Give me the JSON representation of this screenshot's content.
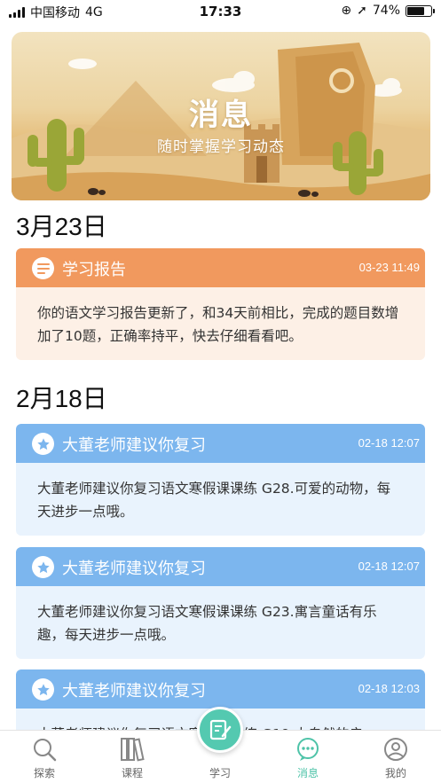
{
  "status_bar": {
    "carrier": "中国移动",
    "network": "4G",
    "time": "17:33",
    "battery_percent": "74%",
    "battery_level": 0.74
  },
  "banner": {
    "title": "消息",
    "subtitle": "随时掌握学习动态"
  },
  "groups": [
    {
      "date": "3月23日",
      "messages": [
        {
          "icon": "list-icon",
          "title": "学习报告",
          "time": "03-23 11:49",
          "body": "你的语文学习报告更新了，和34天前相比，完成的题目数增加了10题，正确率持平，快去仔细看看吧。",
          "color": "#f1995e"
        }
      ]
    },
    {
      "date": "2月18日",
      "messages": [
        {
          "icon": "star-icon",
          "title": "大董老师建议你复习",
          "time": "02-18 12:07",
          "body": "大董老师建议你复习语文寒假课课练 G28.可爱的动物，每天进步一点哦。",
          "color": "#7cb6ee"
        },
        {
          "icon": "star-icon",
          "title": "大董老师建议你复习",
          "time": "02-18 12:07",
          "body": "大董老师建议你复习语文寒假课课练 G23.寓言童话有乐趣，每天进步一点哦。",
          "color": "#7cb6ee"
        },
        {
          "icon": "star-icon",
          "title": "大董老师建议你复习",
          "time": "02-18 12:03",
          "body": "大董老师建议你复习语文寒假课课练 G19.大自然的启",
          "color": "#7cb6ee"
        }
      ]
    }
  ],
  "tabbar": {
    "items": [
      {
        "label": "探索",
        "icon": "search-icon"
      },
      {
        "label": "课程",
        "icon": "books-icon"
      },
      {
        "label": "学习",
        "icon": "study-icon"
      },
      {
        "label": "消息",
        "icon": "chat-icon",
        "active": true
      },
      {
        "label": "我的",
        "icon": "profile-icon"
      }
    ]
  },
  "colors": {
    "accent": "#4ec3a8",
    "report_header": "#f1995e",
    "suggest_header": "#7cb6ee"
  }
}
